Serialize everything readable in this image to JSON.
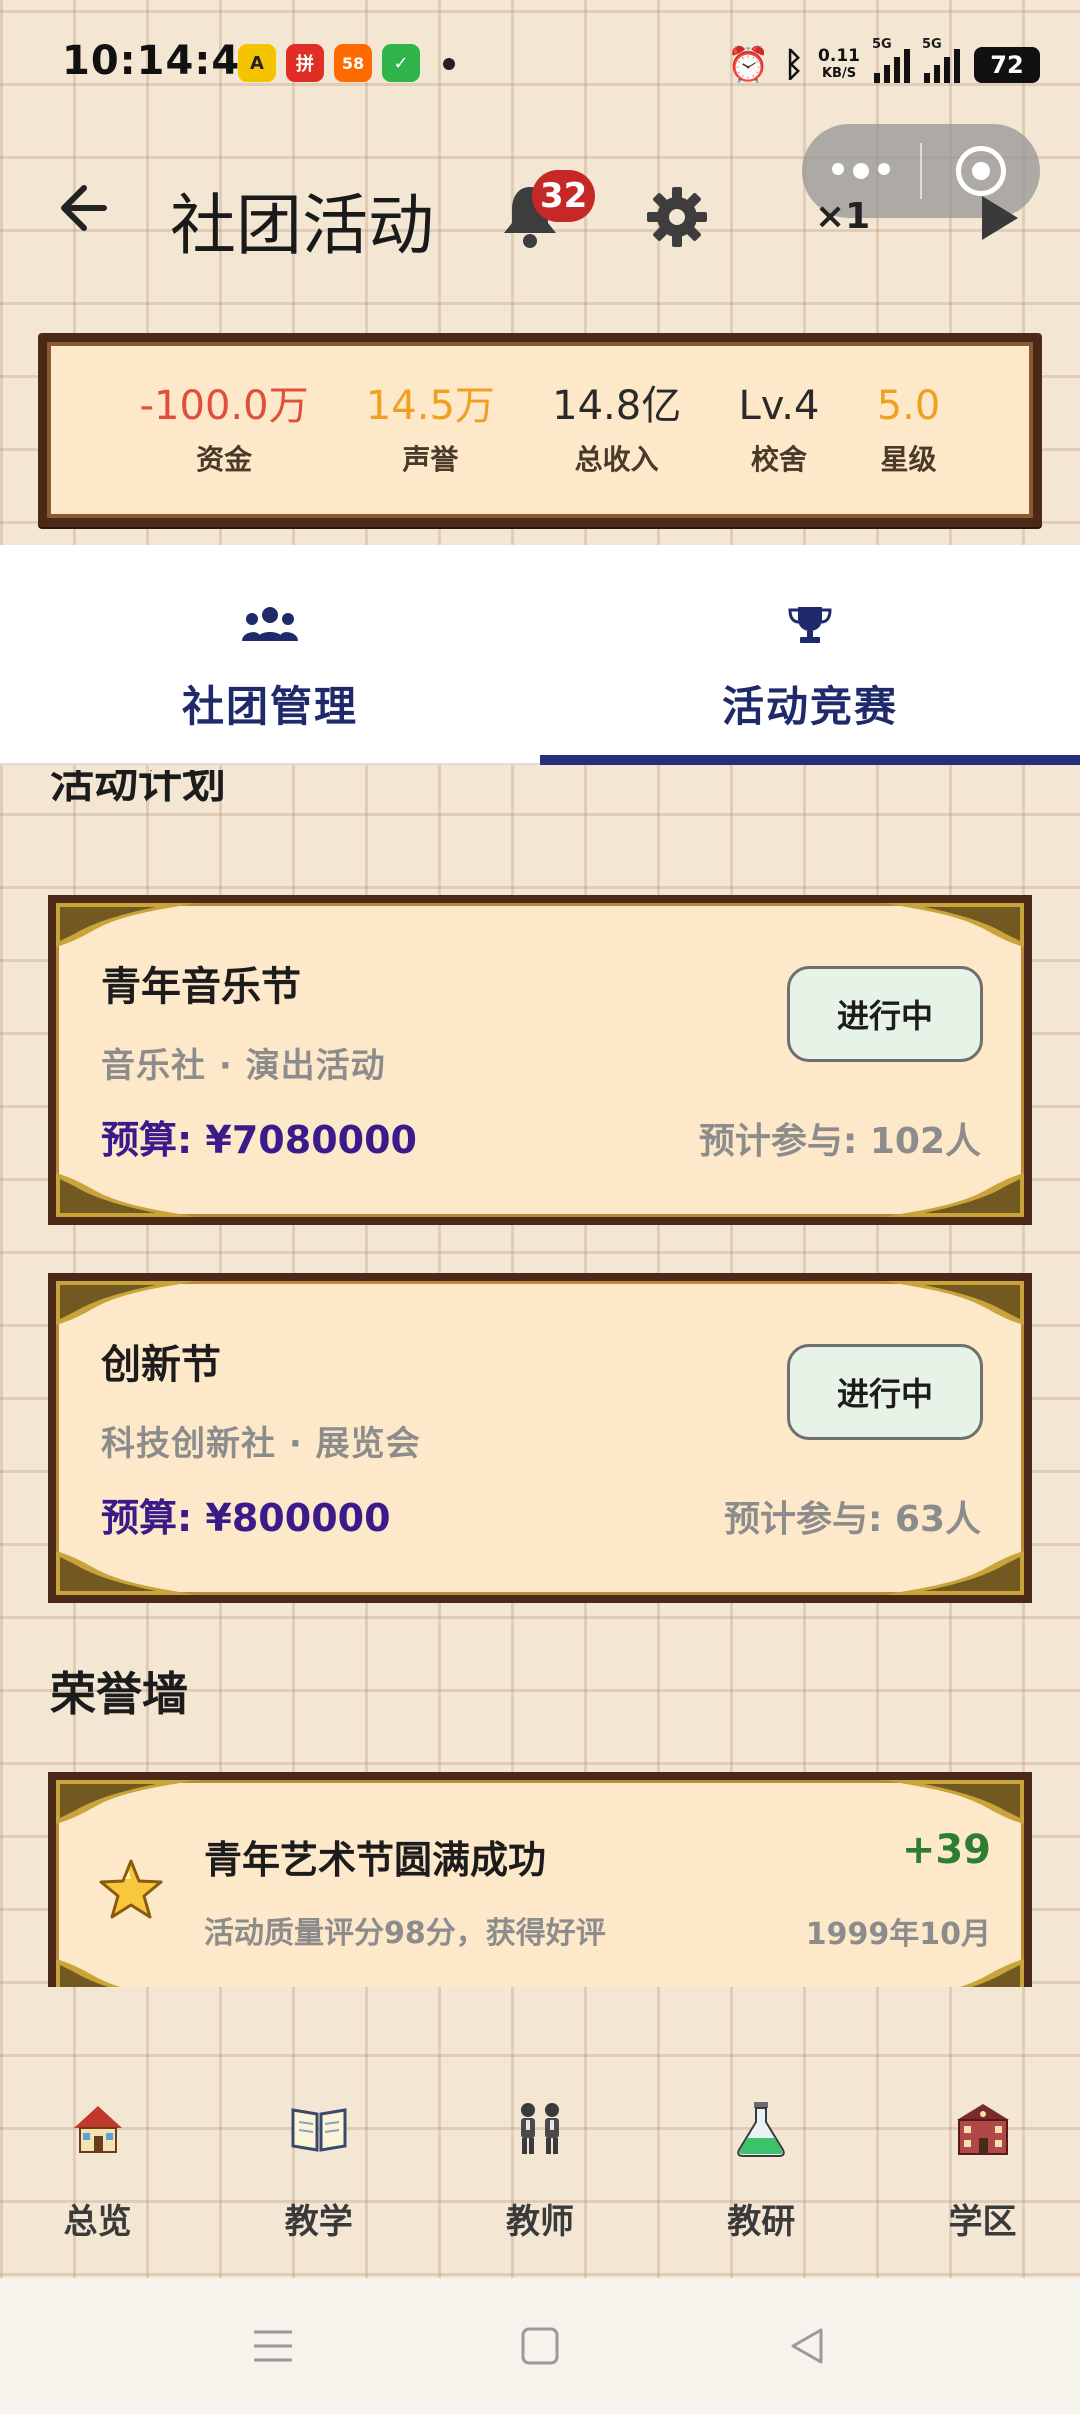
{
  "status_bar": {
    "time": "10:14:44",
    "app_icons": [
      {
        "name": "amap-icon",
        "color": "#f5c400",
        "text": "A"
      },
      {
        "name": "pdd-icon",
        "color": "#e02e24",
        "text": "拼"
      },
      {
        "name": "58-icon",
        "color": "#ff6a00",
        "text": "58"
      },
      {
        "name": "shield-icon",
        "color": "#2fb44a",
        "text": "✓"
      }
    ],
    "network_speed": "0.11\nKB/S",
    "network_speed_top": "0.11",
    "network_speed_unit": "KB/S",
    "signal_label_1": "5G",
    "signal_label_2": "5G",
    "battery": "72"
  },
  "header": {
    "title": "社团活动",
    "notification_count": "32",
    "speed": "×1"
  },
  "stats": [
    {
      "value": "-100.0万",
      "label": "资金",
      "color": "#e04e3c"
    },
    {
      "value": "14.5万",
      "label": "声誉",
      "color": "#f0a020"
    },
    {
      "value": "14.8亿",
      "label": "总收入",
      "color": "#2a2a2a"
    },
    {
      "value": "Lv.4",
      "label": "校舍",
      "color": "#2a2a2a"
    },
    {
      "value": "5.0",
      "label": "星级",
      "color": "#f0a020"
    }
  ],
  "tabs": [
    {
      "label": "社团管理",
      "icon": "group-icon"
    },
    {
      "label": "活动竞赛",
      "icon": "trophy-icon"
    }
  ],
  "activity_section": {
    "title": "活动计划"
  },
  "activities": [
    {
      "title": "青年音乐节",
      "subtitle": "音乐社 · 演出活动",
      "budget": "预算: ¥7080000",
      "participants": "预计参与: 102人",
      "status": "进行中"
    },
    {
      "title": "创新节",
      "subtitle": "科技创新社 · 展览会",
      "budget": "预算: ¥800000",
      "participants": "预计参与: 63人",
      "status": "进行中"
    }
  ],
  "honor_section": {
    "title": "荣誉墙"
  },
  "honors": [
    {
      "title": "青年艺术节圆满成功",
      "description": "活动质量评分98分，获得好评",
      "points": "+39",
      "date": "1999年10月",
      "icon": "star-icon"
    }
  ],
  "bottom_nav": [
    {
      "label": "总览",
      "icon": "house-icon"
    },
    {
      "label": "教学",
      "icon": "book-icon"
    },
    {
      "label": "教师",
      "icon": "teachers-icon"
    },
    {
      "label": "教研",
      "icon": "flask-icon"
    },
    {
      "label": "学区",
      "icon": "school-icon"
    }
  ]
}
